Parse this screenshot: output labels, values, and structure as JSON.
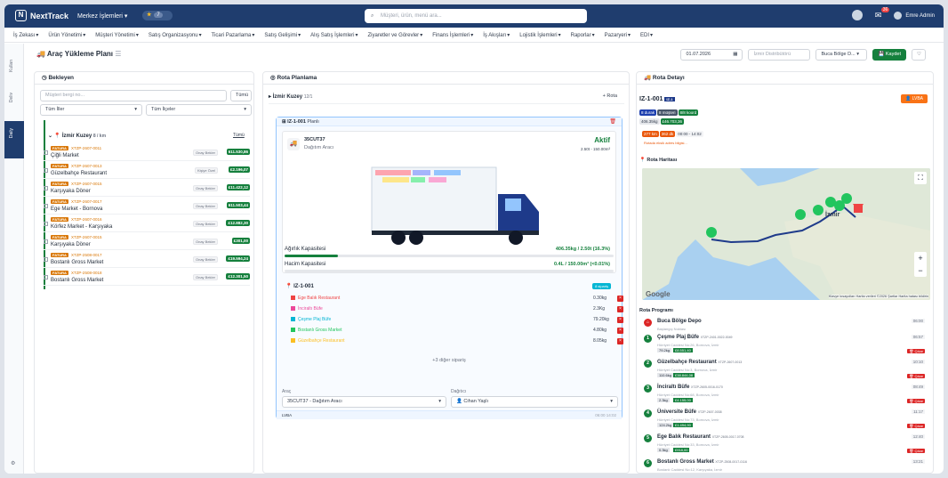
{
  "topbar": {
    "app_name": "NextTrack",
    "context": "Merkez İşlemleri",
    "favorites_count": "7",
    "search_placeholder": "Müşteri, ürün, menü ara...",
    "notif_count": "36",
    "user": "Emre Admin"
  },
  "menu": [
    "İş Zekası",
    "Ürün Yönetimi",
    "Müşteri Yönetimi",
    "Satış Organizasyonu",
    "Ticari Pazarlama",
    "Satış Gelişimi",
    "Alış Satış İşlemleri",
    "Ziyaretler ve Görevler",
    "Finans İşlemleri",
    "İş Akışları",
    "Lojistik İşlemleri",
    "Raporlar",
    "Pazaryeri",
    "EDI"
  ],
  "rail": [
    "Kullan",
    "Deliv",
    "Daily"
  ],
  "page": {
    "title": "Araç Yükleme Planı",
    "date": "01.07.2026",
    "district_placeholder": "İzmir Distribütörü",
    "depot": "Buca Bölge D...",
    "save": "Kaydet"
  },
  "pending": {
    "title": "Bekleyen",
    "search_placeholder": "Müşteri bergi no...",
    "all_btn": "Tümü",
    "filter1": "Tüm İller",
    "filter2": "Tüm İlçeler",
    "group": "İzmir Kuzey",
    "group_meta": "8 / km",
    "group_all": "Tümü",
    "tag": "FATURA",
    "rows": [
      {
        "code": "XTZP-2607-0011",
        "name": "Çiğli Market",
        "status": "Onay Bekler",
        "amount": "611.530,86"
      },
      {
        "code": "XTZP-2607-0013",
        "name": "Güzelbahçe Restaurant",
        "status": "Kişiye Özel",
        "amount": "£2.196,07"
      },
      {
        "code": "XTZP-2607-0015",
        "name": "Karşıyaka Döner",
        "status": "Onay Bekler",
        "amount": "£11.422,12"
      },
      {
        "code": "XTZP-2607-0017",
        "name": "Ege Market - Bornova",
        "status": "Onay Bekler",
        "amount": "611.503,44"
      },
      {
        "code": "XTZP-2607-0016",
        "name": "Körfez Market - Karşıyaka",
        "status": "Onay Bekler",
        "amount": "£12.882,30"
      },
      {
        "code": "XTZP-2607-0015",
        "name": "Karşıyaka Döner",
        "status": "Onay Bekler",
        "amount": "£301,00"
      },
      {
        "code": "XTZP-2508-0017",
        "name": "Bostanlı Gross Market",
        "status": "Onay Bekler",
        "amount": "£19.594,24"
      },
      {
        "code": "XTZP-2508-0018",
        "name": "Bostanlı Gross Market",
        "status": "Onay Bekler",
        "amount": "£12.301,50"
      }
    ]
  },
  "planning": {
    "title": "Rota Planlama",
    "region": "İzmir Kuzey",
    "region_count": "12/1",
    "add_route": "+ Rota",
    "route_code": "IZ-1-001",
    "route_sub": "Planlı",
    "plate": "35CUT37",
    "vehicle_type": "Dağıtım Aracı",
    "status": "Aktif",
    "capacity": "2.50t - 150.00m³",
    "weight_label": "Ağırlık Kapasitesi",
    "weight_value": "406.35kg / 2.50t (16.3%)",
    "weight_pct": 16.3,
    "volume_label": "Hacim Kapasitesi",
    "volume_value": "0.4L / 150.00m³ (<0.01%)",
    "orders_route": "IZ-1-001",
    "orders_badge": "8 sipariş",
    "orders": [
      {
        "name": "Ege Balık Restaurant",
        "weight": "0.30kg",
        "color": "#ef4444"
      },
      {
        "name": "İnciraltı Büfe",
        "weight": "2.3Kg",
        "color": "#ec4899"
      },
      {
        "name": "Çeşme Plaj Büfe",
        "weight": "79.20kg",
        "color": "#06b6d4"
      },
      {
        "name": "Bostanlı Gross Market",
        "weight": "4.80kg",
        "color": "#22c55e"
      },
      {
        "name": "Güzelbahçe Restaurant",
        "weight": "8.05kg",
        "color": "#fbbf24"
      }
    ],
    "more_orders": "+3 diğer sipariş",
    "vehicle_label": "Araç",
    "vehicle_value": "35CUT37 - Dağıtım Aracı",
    "driver_label": "Dağıtıcı",
    "driver_value": "Cihan Yaşlı",
    "footer_left": "LVBA",
    "footer_times": "06:00  14:02"
  },
  "detail": {
    "title": "Rota Detayı",
    "code": "IZ-1-001",
    "code_tag": "IZ-1",
    "lvba": "LVBA",
    "badges": [
      "8 durak",
      "8 müşteri",
      "8/8 koord"
    ],
    "weight": "406.35kg",
    "price": "£46.703,36",
    "km": "277 km",
    "dk": "362 dk",
    "time": "00:00 - 14:02",
    "warn": "Rotada eksik adres bilgisi...",
    "map_title": "Rota Haritası",
    "map_city": "İzmir",
    "program_title": "Rota Programı",
    "depot": {
      "name": "Buca Bölge Depo",
      "addr": "Başlangıç Noktası",
      "time": "06:00"
    },
    "stops": [
      {
        "n": "1",
        "name": "Çeşme Plaj Büfe",
        "code": "XTZP-2401-0022-0049",
        "addr": "Hürriyet Caddesi No:26, Bornova, İzmir",
        "kg": "79.2kg",
        "price": "£8.551,40",
        "time": "06:57"
      },
      {
        "n": "2",
        "name": "Güzelbahçe Restaurant",
        "code": "XTZP-2607-0013",
        "addr": "Hürriyet Caddesi No:3, Bornova, İzmir",
        "kg": "110.6kg",
        "price": "£38.844,08",
        "time": "10:10"
      },
      {
        "n": "3",
        "name": "İnciraltı Büfe",
        "code": "XTZP-2605-0016-0170",
        "addr": "Hürriyet Caddesi No:68, Bornova, İzmir",
        "kg": "2.3kg",
        "price": "£4.155,00",
        "time": "08:49"
      },
      {
        "n": "4",
        "name": "Üniversite Büfe",
        "code": "XTZP-2607-0038",
        "addr": "Hürriyet Caddesi No:73, Bornova, İzmir",
        "kg": "124.2kg",
        "price": "£1.494,90",
        "time": "11:17"
      },
      {
        "n": "5",
        "name": "Ege Balık Restaurant",
        "code": "XTZP-2605-0017-0708",
        "addr": "Hürriyet Caddesi No:33, Bornova, İzmir",
        "kg": "0.3kg",
        "price": "£918,00",
        "time": "12:40"
      },
      {
        "n": "6",
        "name": "Bostanlı Gross Market",
        "code": "XTZP-2508-0017-0116",
        "addr": "Bostanlı Caddesi No:12, Karşıyaka, İzmir",
        "kg": "",
        "price": "",
        "time": "13:21"
      }
    ],
    "remove": "Çıkar",
    "map_credits": "Klavye kısayolları   Harita verileri ©2026   Şartlar   Harita hatası bildirin"
  }
}
